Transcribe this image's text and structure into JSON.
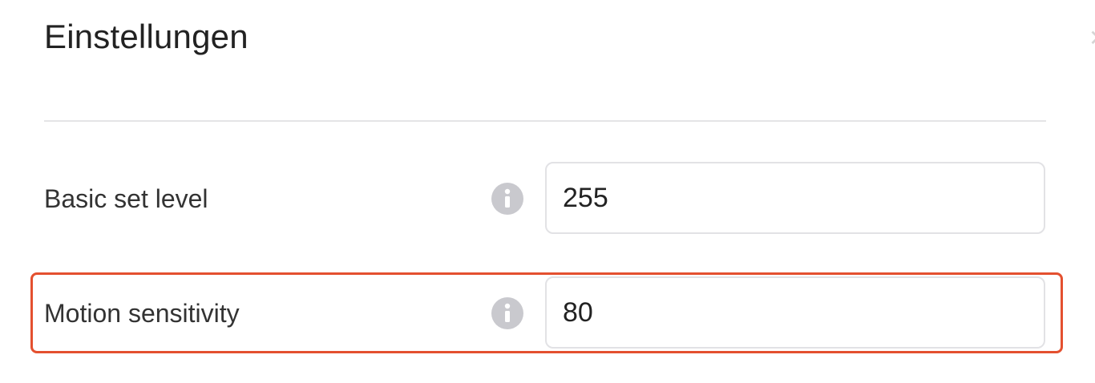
{
  "header": {
    "title": "Einstellungen"
  },
  "settings": [
    {
      "label": "Basic set level",
      "value": "255",
      "info_icon": "info-icon"
    },
    {
      "label": "Motion sensitivity",
      "value": "80",
      "info_icon": "info-icon",
      "highlighted": true
    }
  ],
  "colors": {
    "highlight": "#e4502f",
    "info_icon": "#c9c9ce",
    "divider": "#e4e4e6"
  }
}
